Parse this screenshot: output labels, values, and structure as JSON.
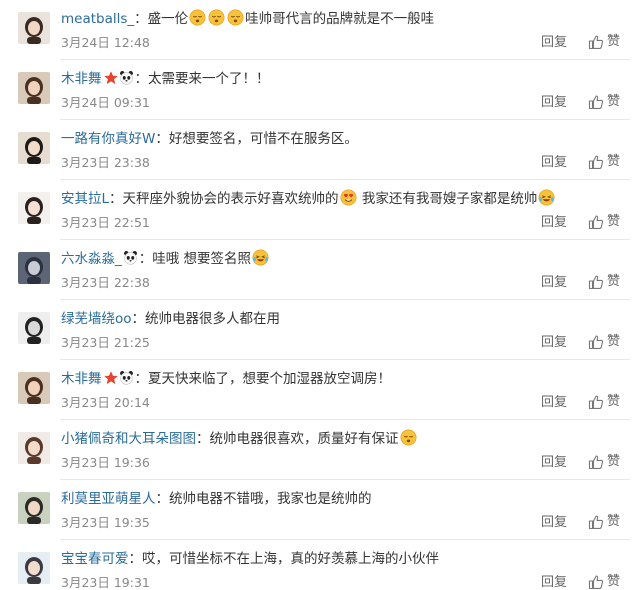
{
  "comments": [
    {
      "user": "meatballs_",
      "badges": [],
      "sep": "：",
      "segments": [
        {
          "t": "text",
          "v": "盛一伦"
        },
        {
          "t": "emoji",
          "v": "sleepy-face"
        },
        {
          "t": "emoji",
          "v": "sleepy-face"
        },
        {
          "t": "emoji",
          "v": "sleepy-face"
        },
        {
          "t": "text",
          "v": "哇帅哥代言的品牌就是不一般哇"
        }
      ],
      "time": "3月24日 12:48",
      "avatar": {
        "bg": "#e9e3dc",
        "hair": "#3a2a22",
        "skin": "#f2d6c6"
      }
    },
    {
      "user": "木非舞",
      "badges": [
        "star-badge",
        "panda-icon"
      ],
      "sep": "：",
      "segments": [
        {
          "t": "text",
          "v": "太需要来一个了！！"
        }
      ],
      "time": "3月24日 09:31",
      "avatar": {
        "bg": "#d9c9b8",
        "hair": "#4a3020",
        "skin": "#f1d2bd"
      }
    },
    {
      "user": "一路有你真好W",
      "badges": [],
      "sep": "：",
      "segments": [
        {
          "t": "text",
          "v": "好想要签名，可惜不在服务区。"
        }
      ],
      "time": "3月23日 23:38",
      "avatar": {
        "bg": "#e6ddd0",
        "hair": "#1e1a18",
        "skin": "#f3dcc9"
      }
    },
    {
      "user": "安其拉L",
      "badges": [],
      "sep": "：",
      "segments": [
        {
          "t": "text",
          "v": "天秤座外貌协会的表示好喜欢统帅的"
        },
        {
          "t": "emoji",
          "v": "heart-eyes-face"
        },
        {
          "t": "text",
          "v": " 我家还有我哥嫂子家都是统帅"
        },
        {
          "t": "emoji",
          "v": "laughing-tears-face"
        }
      ],
      "time": "3月23日 22:51",
      "avatar": {
        "bg": "#f3f0ee",
        "hair": "#2b2220",
        "skin": "#f5e0d3"
      }
    },
    {
      "user": "六水淼淼_",
      "badges": [
        "panda-icon"
      ],
      "sep": "：",
      "segments": [
        {
          "t": "text",
          "v": "哇哦  想要签名照"
        },
        {
          "t": "emoji",
          "v": "laughing-tears-face"
        }
      ],
      "time": "3月23日 22:38",
      "avatar": {
        "bg": "#5b6576",
        "hair": "#2b3140",
        "skin": "#c8ccd4"
      }
    },
    {
      "user": "绿芜墙绕oo",
      "badges": [],
      "sep": "：",
      "segments": [
        {
          "t": "text",
          "v": "统帅电器很多人都在用"
        }
      ],
      "time": "3月23日 21:25",
      "avatar": {
        "bg": "#eeeeee",
        "hair": "#222222",
        "skin": "#d9d9d9"
      }
    },
    {
      "user": "木非舞",
      "badges": [
        "star-badge",
        "panda-icon"
      ],
      "sep": "：",
      "segments": [
        {
          "t": "text",
          "v": "夏天快来临了，想要个加湿器放空调房！"
        }
      ],
      "time": "3月23日 20:14",
      "avatar": {
        "bg": "#d9c9b8",
        "hair": "#4a3020",
        "skin": "#f1d2bd"
      }
    },
    {
      "user": "小猪佩奇和大耳朵图图",
      "badges": [],
      "sep": "：",
      "segments": [
        {
          "t": "text",
          "v": "统帅电器很喜欢，质量好有保证"
        },
        {
          "t": "emoji",
          "v": "sleepy-face"
        }
      ],
      "time": "3月23日 19:36",
      "avatar": {
        "bg": "#f0ebe6",
        "hair": "#5a3a2a",
        "skin": "#f4dccd"
      }
    },
    {
      "user": "利莫里亚萌星人",
      "badges": [],
      "sep": "：",
      "segments": [
        {
          "t": "text",
          "v": "统帅电器不错哦，我家也是统帅的"
        }
      ],
      "time": "3月23日 19:35",
      "avatar": {
        "bg": "#c9d1bf",
        "hair": "#2a2a26",
        "skin": "#f0d8c4"
      }
    },
    {
      "user": "宝宝春可爱",
      "badges": [],
      "sep": "：",
      "segments": [
        {
          "t": "text",
          "v": "哎，可惜坐标不在上海，真的好羡慕上海的小伙伴"
        }
      ],
      "time": "3月23日 19:31",
      "avatar": {
        "bg": "#e7eef3",
        "hair": "#3a3a40",
        "skin": "#f1dccd"
      }
    }
  ],
  "actions": {
    "reply_label": "回复",
    "like_label": "赞",
    "like_icon": "thumbs-up-icon"
  },
  "colors": {
    "username": "#2a6c9b",
    "meta": "#888888",
    "text": "#333333"
  }
}
